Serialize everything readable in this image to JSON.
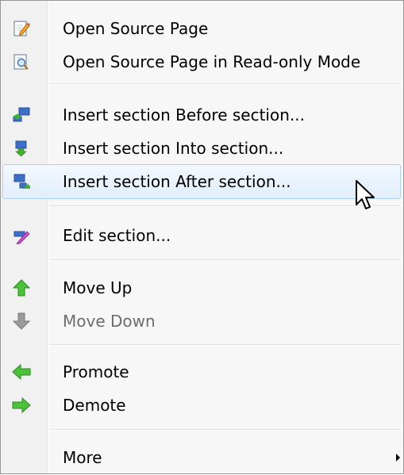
{
  "menu": {
    "items": [
      {
        "label": "Open Source Page",
        "icon": "edit-page-icon"
      },
      {
        "label": "Open Source Page in Read-only Mode",
        "icon": "view-page-icon"
      },
      {
        "label": "Insert section Before section...",
        "icon": "insert-before-icon"
      },
      {
        "label": "Insert section Into section...",
        "icon": "insert-into-icon"
      },
      {
        "label": "Insert section After section...",
        "icon": "insert-after-icon"
      },
      {
        "label": "Edit section...",
        "icon": "edit-section-icon"
      },
      {
        "label": "Move Up",
        "icon": "arrow-up-icon"
      },
      {
        "label": "Move Down",
        "icon": "arrow-down-icon",
        "disabled": true
      },
      {
        "label": "Promote",
        "icon": "arrow-left-icon"
      },
      {
        "label": "Demote",
        "icon": "arrow-right-icon"
      },
      {
        "label": "More",
        "submenu": true
      }
    ],
    "hovered_item": "Insert section After section...",
    "colors": {
      "background": "#f7f7f7",
      "hover_border": "#aecff7",
      "disabled_text": "#6d6d6d",
      "arrow_green": "#3cb32a",
      "arrow_gray": "#8a8a8a"
    }
  }
}
